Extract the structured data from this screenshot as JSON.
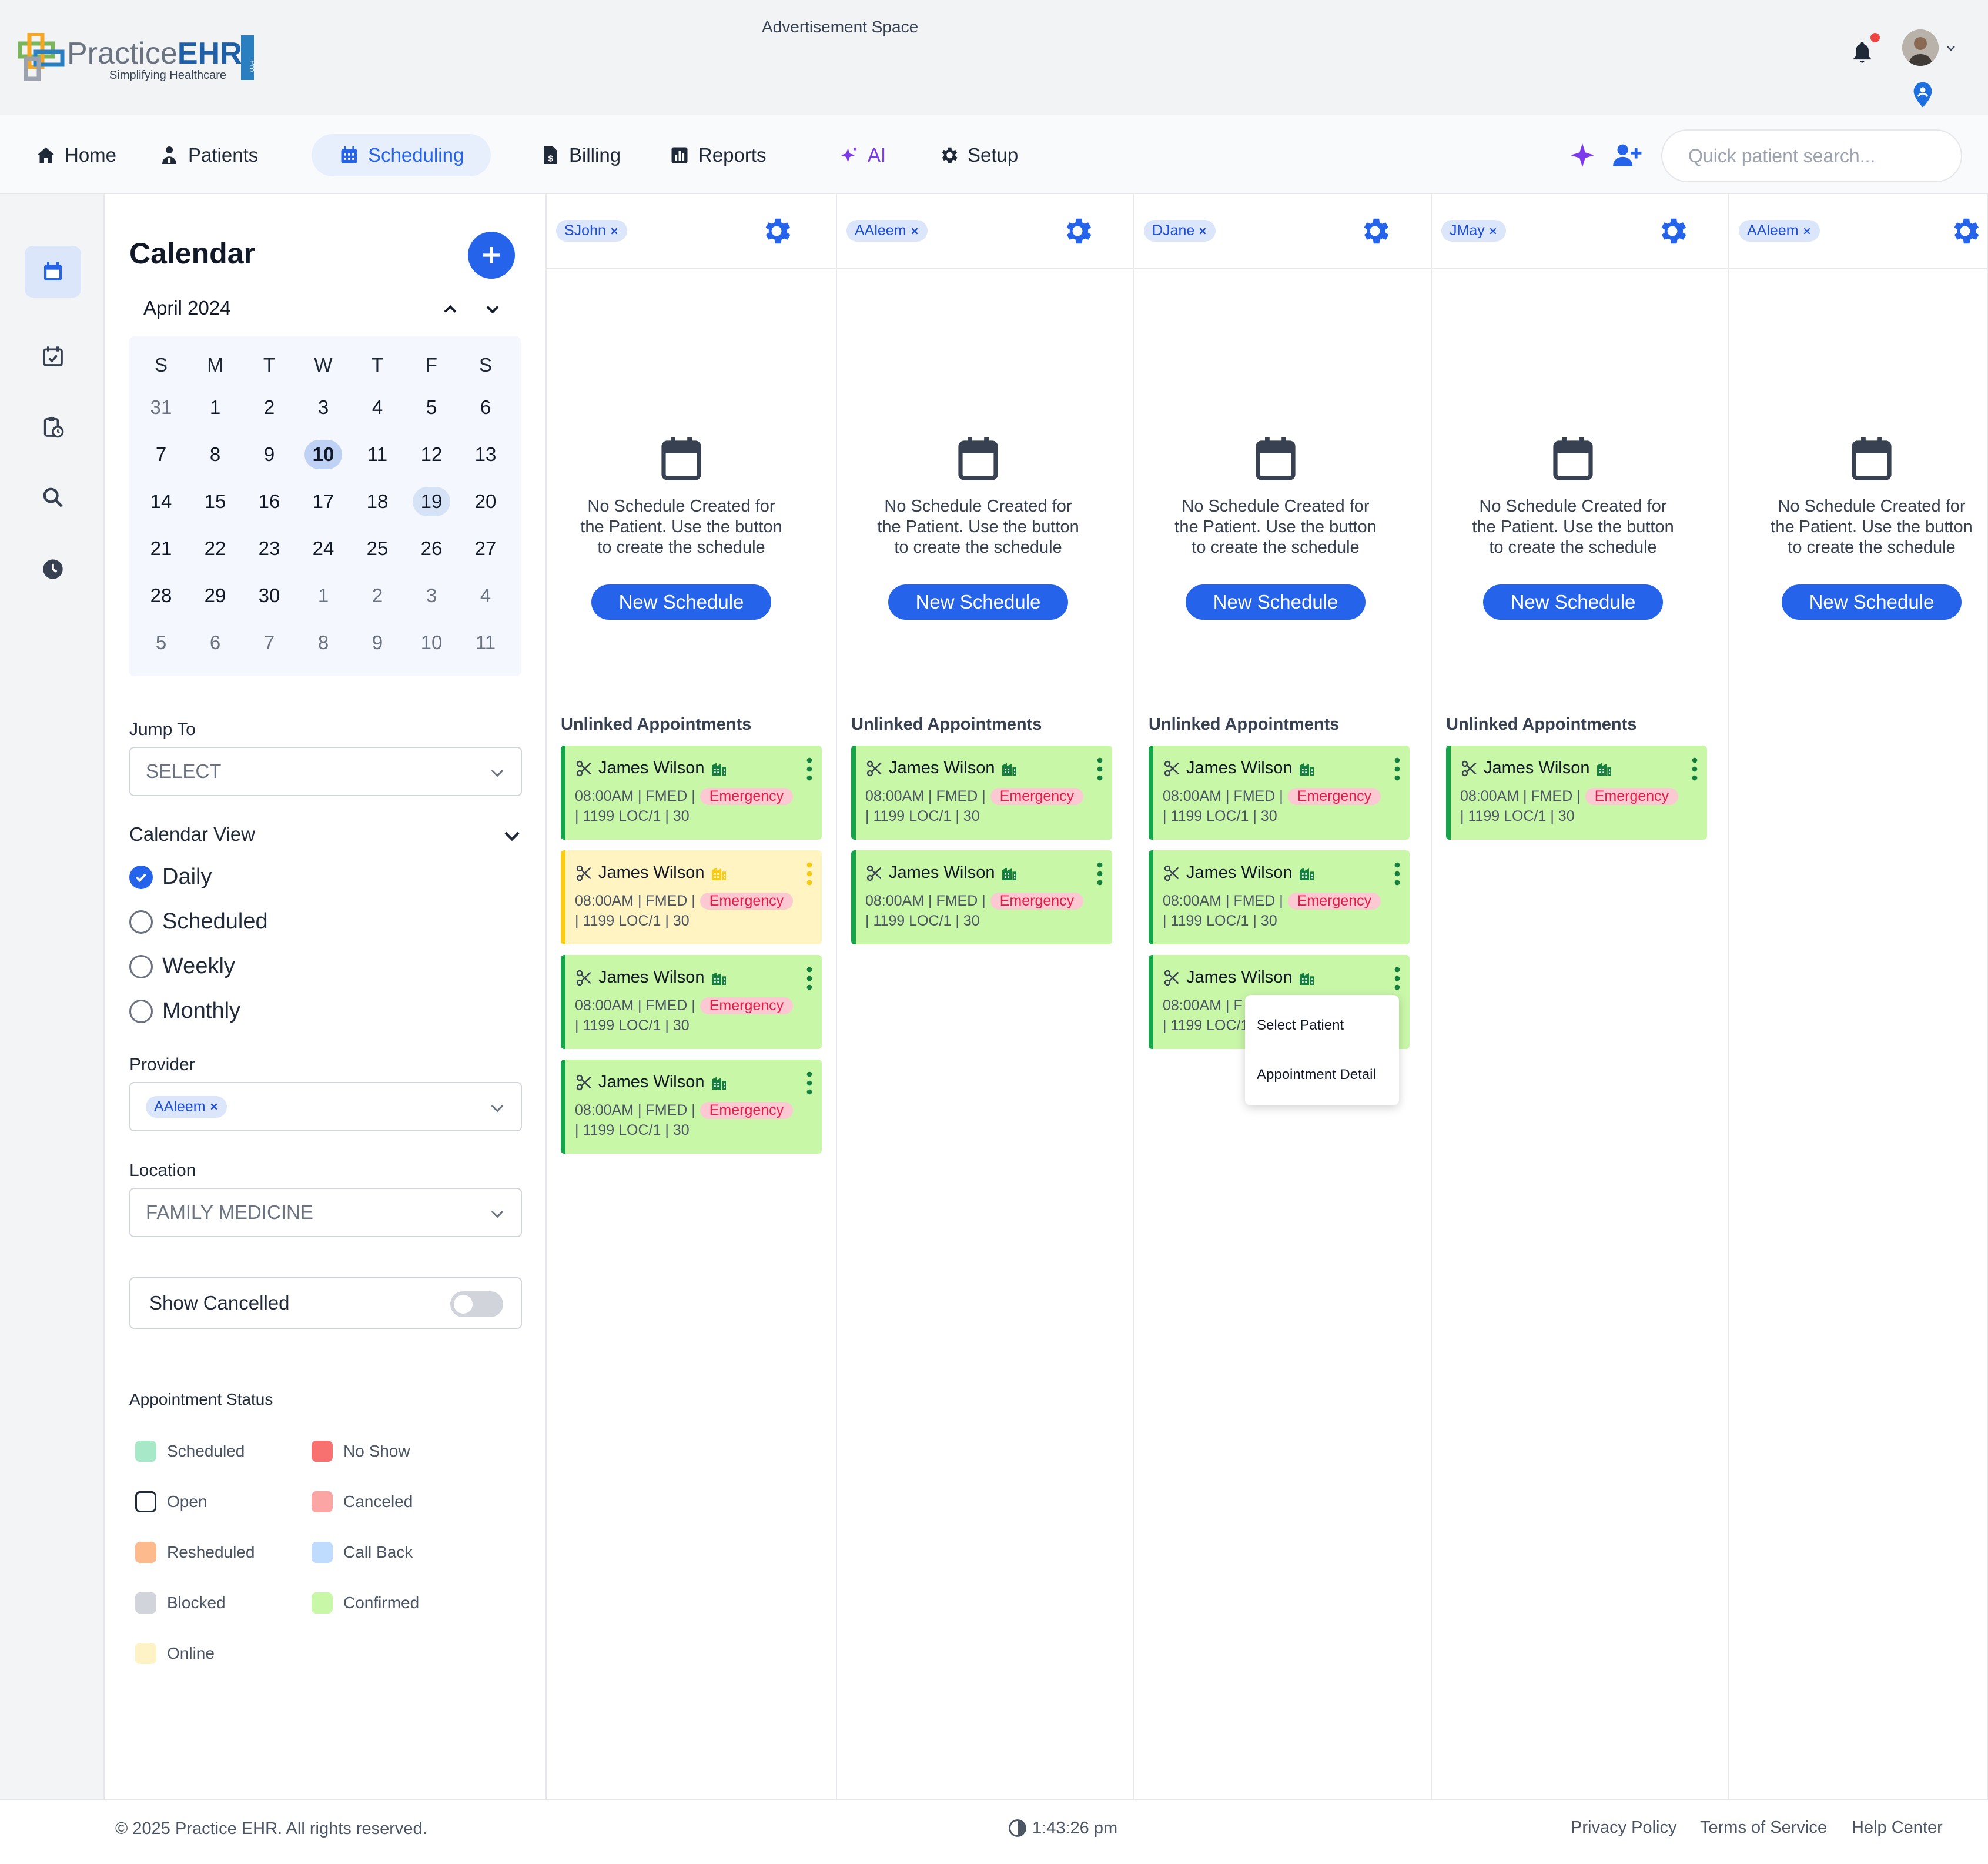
{
  "header": {
    "advertisement": "Advertisement Space",
    "logo_main": "PracticeEHR",
    "logo_tagline": "Simplifying Healthcare",
    "logo_badge": "Pro"
  },
  "nav": {
    "items": [
      {
        "label": "Home",
        "icon": "home-icon"
      },
      {
        "label": "Patients",
        "icon": "patients-icon"
      },
      {
        "label": "Scheduling",
        "icon": "calendar-icon",
        "active": true
      },
      {
        "label": "Billing",
        "icon": "billing-icon"
      },
      {
        "label": "Reports",
        "icon": "reports-icon"
      },
      {
        "label": "AI",
        "icon": "sparkle-icon"
      },
      {
        "label": "Setup",
        "icon": "gear-icon"
      }
    ],
    "search_placeholder": "Quick patient search..."
  },
  "calendar": {
    "title": "Calendar",
    "month": "April 2024",
    "weekdays": [
      "S",
      "M",
      "T",
      "W",
      "T",
      "F",
      "S"
    ],
    "weeks": [
      [
        "31",
        "1",
        "2",
        "3",
        "4",
        "5",
        "6"
      ],
      [
        "7",
        "8",
        "9",
        "10",
        "11",
        "12",
        "13"
      ],
      [
        "14",
        "15",
        "16",
        "17",
        "18",
        "19",
        "20"
      ],
      [
        "21",
        "22",
        "23",
        "24",
        "25",
        "26",
        "27"
      ],
      [
        "28",
        "29",
        "30",
        "1",
        "2",
        "3",
        "4"
      ],
      [
        "5",
        "6",
        "7",
        "8",
        "9",
        "10",
        "11"
      ]
    ],
    "selected_day": "10",
    "highlighted_day": "19"
  },
  "filters": {
    "jump_to_label": "Jump To",
    "jump_to_value": "SELECT",
    "view_label": "Calendar View",
    "views": [
      "Daily",
      "Scheduled",
      "Weekly",
      "Monthly"
    ],
    "selected_view": "Daily",
    "provider_label": "Provider",
    "provider_chip": "AAleem",
    "location_label": "Location",
    "location_value": "FAMILY MEDICINE",
    "show_cancelled_label": "Show Cancelled",
    "show_cancelled": false
  },
  "legend": {
    "title": "Appointment Status",
    "items": [
      {
        "label": "Scheduled",
        "color": "#a7e8c9"
      },
      {
        "label": "No Show",
        "color": "#f87171"
      },
      {
        "label": "Open",
        "color": "#ffffff"
      },
      {
        "label": "Canceled",
        "color": "#fca5a5"
      },
      {
        "label": "Resheduled",
        "color": "#fdba8c"
      },
      {
        "label": "Call Back",
        "color": "#bfdbfe"
      },
      {
        "label": "Blocked",
        "color": "#d1d5db"
      },
      {
        "label": "Confirmed",
        "color": "#c9f7a8"
      },
      {
        "label": "Online",
        "color": "#fef3c7"
      }
    ]
  },
  "columns": [
    {
      "provider": "SJohn",
      "appointments": [
        {
          "status": "Confirmed"
        },
        {
          "status": "Online"
        },
        {
          "status": "Confirmed"
        },
        {
          "status": "Confirmed"
        }
      ]
    },
    {
      "provider": "AAleem",
      "appointments": [
        {
          "status": "Confirmed"
        },
        {
          "status": "Confirmed"
        }
      ]
    },
    {
      "provider": "DJane",
      "appointments": [
        {
          "status": "Confirmed"
        },
        {
          "status": "Confirmed"
        },
        {
          "status": "Confirmed"
        }
      ]
    },
    {
      "provider": "JMay",
      "appointments": [
        {
          "status": "Confirmed"
        }
      ]
    },
    {
      "provider": "AAleem",
      "appointments": []
    }
  ],
  "schedule_empty": {
    "message_line1": "No Schedule Created for",
    "message_line2": "the Patient. Use the button",
    "message_line3": "to create the schedule",
    "button": "New Schedule",
    "unlinked_title": "Unlinked Appointments"
  },
  "appointment": {
    "patient": "James Wilson",
    "time": "08:00AM",
    "dept": "FMED",
    "type": "Emergency",
    "room": "1199 LOC/1",
    "duration": "30",
    "line2_prefix": "08:00AM | FMED |",
    "line3": "| 1199 LOC/1 | 30"
  },
  "context_menu": {
    "items": [
      "Select Patient",
      "Appointment Detail"
    ],
    "partial_line2": "08:00AM | F",
    "partial_line3": "| 1199 LOC/1"
  },
  "footer": {
    "copyright": "© 2025 Practice EHR. All rights reserved.",
    "time": "1:43:26 pm",
    "links": [
      "Privacy Policy",
      "Terms of Service",
      "Help Center"
    ]
  },
  "colors": {
    "accent": "#2563eb",
    "confirmed": "#c9f7a8",
    "online": "#fff4c2",
    "emergency_tag": "#fbc9d2"
  }
}
